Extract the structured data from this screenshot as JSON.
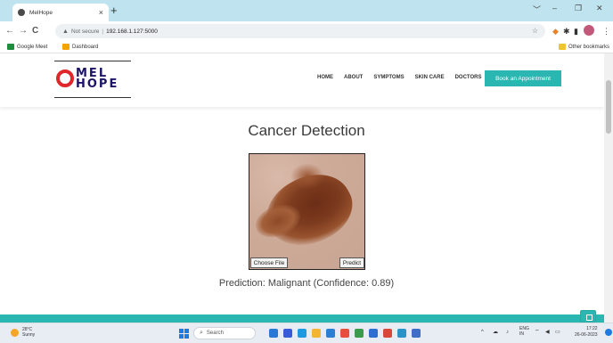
{
  "browser": {
    "tab_title": "MelHope",
    "tab_close": "×",
    "new_tab": "+",
    "window_controls": [
      "﹀",
      "–",
      "❐",
      "✕"
    ],
    "nav": {
      "back": "←",
      "forward": "→",
      "reload": "C"
    },
    "security_label": "Not secure",
    "url": "192.168.1.127:5000",
    "bookmarks": [
      {
        "label": "Google Meet",
        "color": "#1e8e3e"
      },
      {
        "label": "Dashboard",
        "color": "#f4a300"
      }
    ],
    "other_bookmarks": "Other bookmarks"
  },
  "site": {
    "logo": {
      "line1": "MEL",
      "line2": "HOPE"
    },
    "nav": [
      "HOME",
      "ABOUT",
      "SYMPTOMS",
      "SKIN CARE",
      "DOCTORS"
    ],
    "cta": "Book an Appointment",
    "accent": "#2ab7b1"
  },
  "main": {
    "title": "Cancer Detection",
    "choose_file": "Choose File",
    "predict": "Predict",
    "prediction": "Prediction: Malignant (Confidence: 0.89)"
  },
  "taskbar": {
    "weather_temp": "28°C",
    "weather_desc": "Sunny",
    "search": "Search",
    "language": "ENG",
    "region": "IN",
    "time": "17:22",
    "date": "26-06-2023"
  }
}
